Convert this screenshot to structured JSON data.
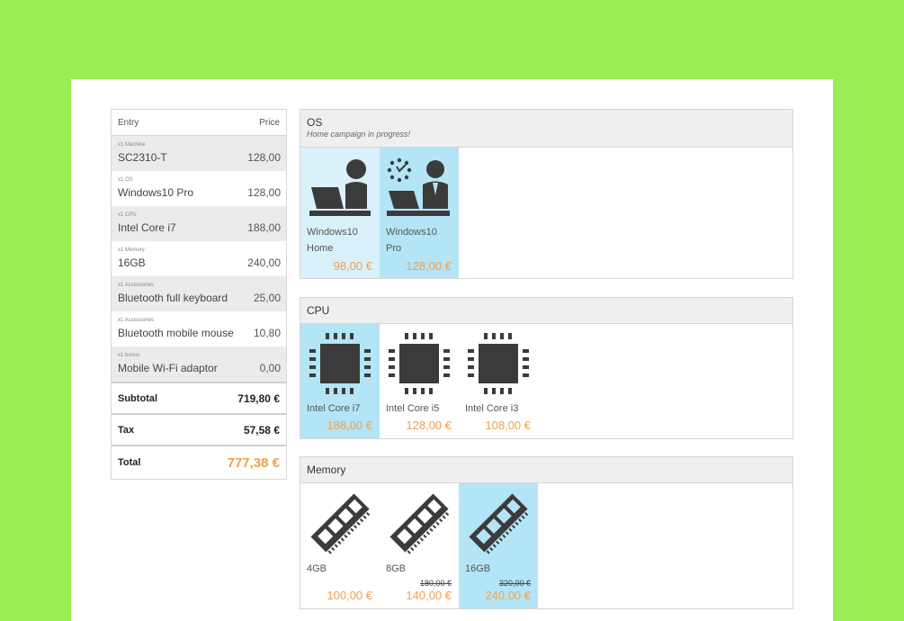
{
  "cart": {
    "header": {
      "entry": "Entry",
      "price": "Price"
    },
    "items": [
      {
        "category": "x1  Machine",
        "name": "SC2310-T",
        "price": "128,00"
      },
      {
        "category": "x1  OS",
        "name": "Windows10 Pro",
        "price": "128,00"
      },
      {
        "category": "x1  CPU",
        "name": "Intel Core i7",
        "price": "188,00"
      },
      {
        "category": "x1  Memory",
        "name": "16GB",
        "price": "240,00"
      },
      {
        "category": "x1  Accessories",
        "name": "Bluetooth full keyboard",
        "price": "25,00"
      },
      {
        "category": "x1  Accessories",
        "name": "Bluetooth mobile mouse",
        "price": "10,80"
      },
      {
        "category": "x1  bonus",
        "name": "Mobile Wi-Fi adaptor",
        "price": "0,00"
      }
    ],
    "subtotal_label": "Subtotal",
    "subtotal": "719,80 €",
    "tax_label": "Tax",
    "tax": "57,58 €",
    "total_label": "Total",
    "total": "777,38 €"
  },
  "os": {
    "title": "OS",
    "note": "Home campaign in progress!",
    "options": [
      {
        "line1": "Windows10",
        "line2": "Home",
        "price": "98,00 €",
        "icon": "laptop-user-icon"
      },
      {
        "line1": "Windows10",
        "line2": "Pro",
        "price": "128,00 €",
        "icon": "business-laptop-icon"
      }
    ]
  },
  "cpu": {
    "title": "CPU",
    "options": [
      {
        "label": "Intel Core i7",
        "price": "188,00 €",
        "icon": "cpu-chip-icon"
      },
      {
        "label": "Intel Core i5",
        "price": "128,00 €",
        "icon": "cpu-chip-icon"
      },
      {
        "label": "Intel Core i3",
        "price": "108,00 €",
        "icon": "cpu-chip-icon"
      }
    ]
  },
  "memory": {
    "title": "Memory",
    "options": [
      {
        "label": "4GB",
        "old_price": "",
        "price": "100,00 €",
        "icon": "ram-module-icon"
      },
      {
        "label": "8GB",
        "old_price": "180,00 €",
        "price": "140,00 €",
        "icon": "ram-module-icon"
      },
      {
        "label": "16GB",
        "old_price": "320,00 €",
        "price": "240,00 €",
        "icon": "ram-module-icon"
      }
    ]
  },
  "colors": {
    "background": "#9bee55",
    "accent_price": "#f0a050",
    "selected_tile": "#b3e5f6",
    "highlight_tile": "#d9f1fa"
  }
}
